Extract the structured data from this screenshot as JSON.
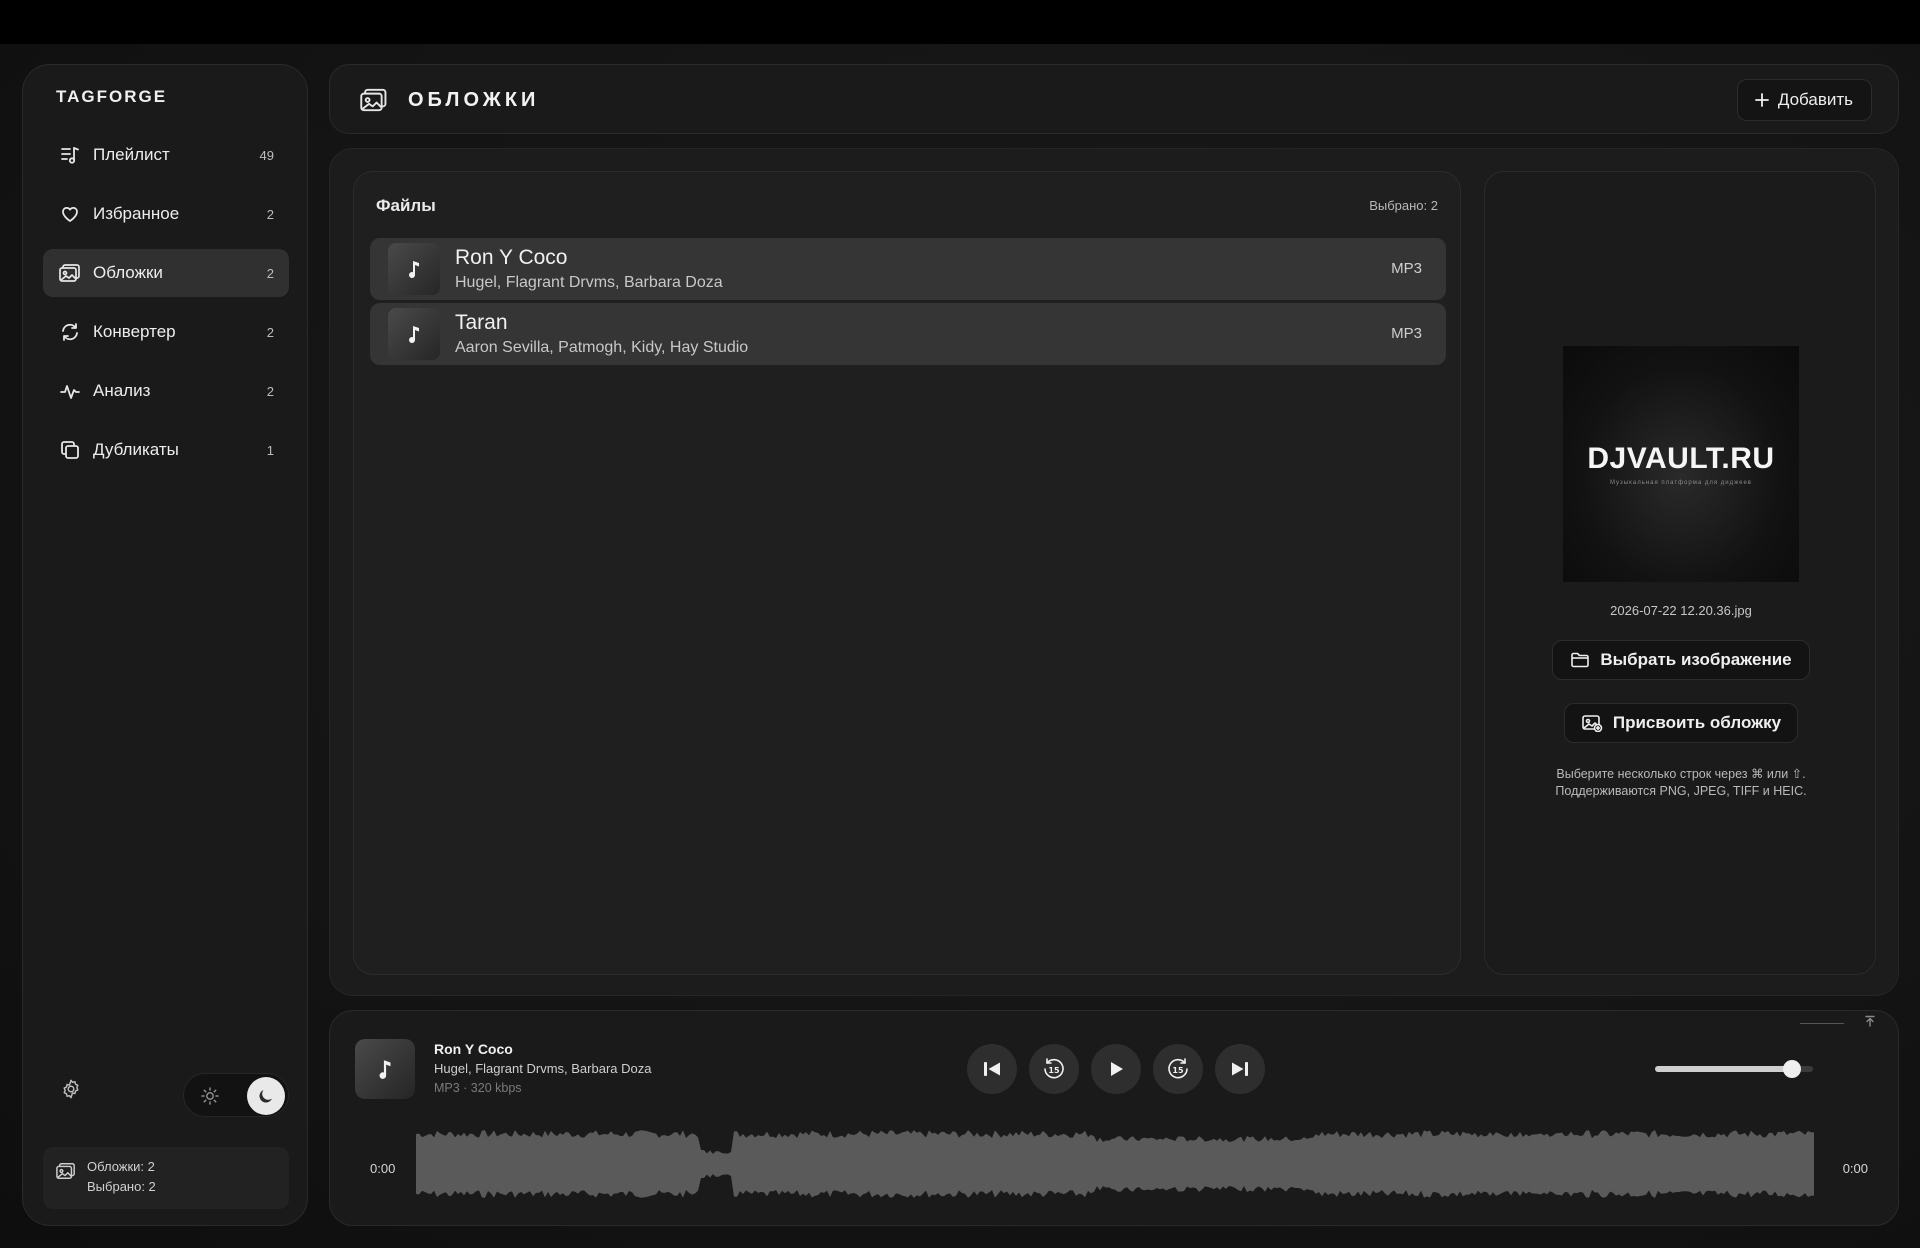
{
  "app": {
    "name": "TAGFORGE"
  },
  "sidebar": {
    "items": [
      {
        "label": "Плейлист",
        "count": "49",
        "icon": "playlist-icon"
      },
      {
        "label": "Избранное",
        "count": "2",
        "icon": "heart-icon"
      },
      {
        "label": "Обложки",
        "count": "2",
        "icon": "cover-icon",
        "active": true
      },
      {
        "label": "Конвертер",
        "count": "2",
        "icon": "convert-icon"
      },
      {
        "label": "Анализ",
        "count": "2",
        "icon": "pulse-icon"
      },
      {
        "label": "Дубликаты",
        "count": "1",
        "icon": "duplicate-icon"
      }
    ],
    "status": {
      "line1": "Обложки: 2",
      "line2": "Выбрано: 2"
    },
    "theme": "dark"
  },
  "header": {
    "title": "ОБЛОЖКИ",
    "add_label": "Добавить"
  },
  "files": {
    "title": "Файлы",
    "selected": "Выбрано: 2",
    "rows": [
      {
        "title": "Ron Y Coco",
        "artist": "Hugel, Flagrant Drvms, Barbara Doza",
        "format": "MP3"
      },
      {
        "title": "Taran",
        "artist": "Aaron Sevilla, Patmogh, Kidy, Hay Studio",
        "format": "MP3"
      }
    ]
  },
  "cover": {
    "logo_text": "DJVAULT.RU",
    "logo_sub": "Музыкальная платформа для диджеев",
    "file_name": "2026-07-22 12.20.36.jpg",
    "choose_label": "Выбрать изображение",
    "assign_label": "Присвоить обложку",
    "hint_line1": "Выберите несколько строк через ⌘ или ⇧.",
    "hint_line2": "Поддерживаются PNG, JPEG, TIFF и HEIC."
  },
  "player": {
    "title": "Ron Y Coco",
    "artist": "Hugel, Flagrant Drvms, Barbara Doza",
    "meta": "MP3 · 320 kbps",
    "time_current": "0:00",
    "time_total": "0:00",
    "volume": 0.87,
    "colors": {
      "wave": "#5a5a5a",
      "accent": "#efefef"
    }
  }
}
